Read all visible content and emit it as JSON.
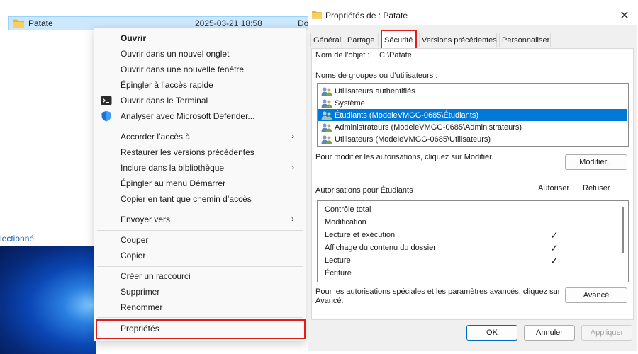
{
  "explorer": {
    "file_name": "Patate",
    "file_date": "2025-03-21 18:58",
    "file_type_truncated": "Do",
    "selected_status": "lectionné"
  },
  "context_menu": {
    "items": [
      {
        "label": "Ouvrir",
        "bold": true
      },
      {
        "label": "Ouvrir dans un nouvel onglet"
      },
      {
        "label": "Ouvrir dans une nouvelle fenêtre"
      },
      {
        "label": "Épingler à l’accès rapide"
      },
      {
        "label": "Ouvrir dans le Terminal",
        "icon": "terminal-icon"
      },
      {
        "label": "Analyser avec Microsoft Defender...",
        "icon": "defender-shield-icon"
      },
      {
        "label": "Accorder l’accès à",
        "submenu": true
      },
      {
        "label": "Restaurer les versions précédentes"
      },
      {
        "label": "Inclure dans la bibliothèque",
        "submenu": true
      },
      {
        "label": "Épingler au menu Démarrer"
      },
      {
        "label": "Copier en tant que chemin d’accès"
      },
      {
        "label": "Envoyer vers",
        "submenu": true
      },
      {
        "label": "Couper"
      },
      {
        "label": "Copier"
      },
      {
        "label": "Créer un raccourci"
      },
      {
        "label": "Supprimer"
      },
      {
        "label": "Renommer"
      },
      {
        "label": "Propriétés",
        "highlighted": true
      }
    ],
    "highlight_color": "#e01e1e"
  },
  "dialog": {
    "title": "Propriétés de : Patate",
    "tabs": [
      {
        "label": "Général"
      },
      {
        "label": "Partage"
      },
      {
        "label": "Sécurité",
        "active": true
      },
      {
        "label": "Versions précédentes"
      },
      {
        "label": "Personnaliser"
      }
    ],
    "object_name_label": "Nom de l’objet :",
    "object_name_value": "C:\\Patate",
    "groups_label": "Noms de groupes ou d’utilisateurs :",
    "groups": [
      {
        "label": "Utilisateurs authentifiés"
      },
      {
        "label": "Système"
      },
      {
        "label": "Étudiants (ModeleVMGG-0685\\Étudiants)",
        "selected": true
      },
      {
        "label": "Administrateurs (ModeleVMGG-0685\\Administrateurs)"
      },
      {
        "label": "Utilisateurs (ModeleVMGG-0685\\Utilisateurs)"
      }
    ],
    "modify_hint": "Pour modifier les autorisations, cliquez sur Modifier.",
    "modify_button": "Modifier...",
    "permissions_for": "Autorisations pour Étudiants",
    "allow_header": "Autoriser",
    "deny_header": "Refuser",
    "permissions": [
      {
        "label": "Contrôle total",
        "allow": false
      },
      {
        "label": "Modification",
        "allow": false
      },
      {
        "label": "Lecture et exécution",
        "allow": true
      },
      {
        "label": "Affichage du contenu du dossier",
        "allow": true
      },
      {
        "label": "Lecture",
        "allow": true
      },
      {
        "label": "Écriture",
        "allow": false
      }
    ],
    "check_glyph": "✓",
    "advanced_hint_line1": "Pour les autorisations spéciales et les paramètres avancés, cliquez sur",
    "advanced_hint_line2": "Avancé.",
    "advanced_button": "Avancé",
    "ok_button": "OK",
    "cancel_button": "Annuler",
    "apply_button": "Appliquer",
    "accent_color": "#0078d7"
  }
}
